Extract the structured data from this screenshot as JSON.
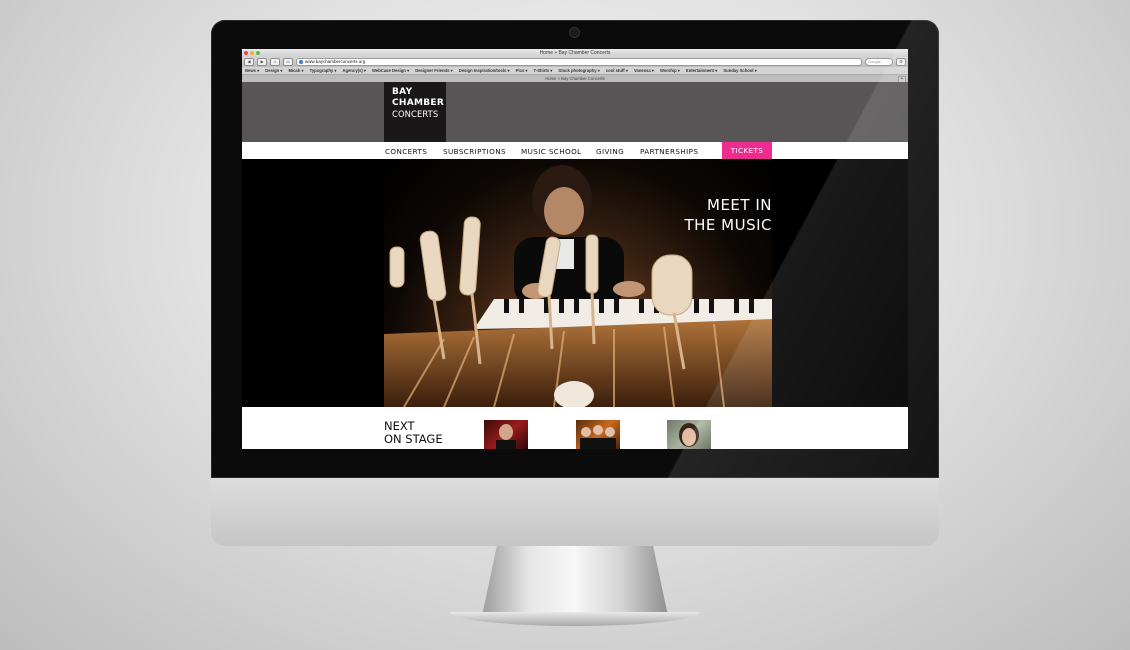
{
  "browser": {
    "window_title": "Home » Bay Chamber Concerts",
    "url": "www.baychamberconcerts.org",
    "search_placeholder": "Google",
    "tab_title": "Home » Bay Chamber Concerts",
    "bookmarks": [
      "News ▾",
      "Design ▾",
      "Micah ▾",
      "Typography ▾",
      "Agency(s) ▾",
      "WebCase Design ▾",
      "Designer Friends ▾",
      "Design Inspiration/tools ▾",
      "Pics ▾",
      "T-Shirts ▾",
      "Stock photography ▾",
      "cool stuff ▾",
      "Vanessa ▾",
      "Worship ▾",
      "Entertainment ▾",
      "Sunday School ▾"
    ]
  },
  "site": {
    "logo": {
      "line1": "BAY",
      "line2": "CHAMBER",
      "line3": "CONCERTS"
    },
    "nav": [
      "CONCERTS",
      "SUBSCRIPTIONS",
      "MUSIC SCHOOL",
      "GIVING",
      "PARTNERSHIPS"
    ],
    "tickets_label": "TICKETS",
    "hero": {
      "line1": "MEET IN",
      "line2": "THE MUSIC"
    },
    "next": {
      "line1": "NEXT",
      "line2": "ON STAGE"
    }
  },
  "colors": {
    "accent": "#ec2c8e",
    "header_bg": "#575555",
    "logo_bg": "#1a1718"
  }
}
